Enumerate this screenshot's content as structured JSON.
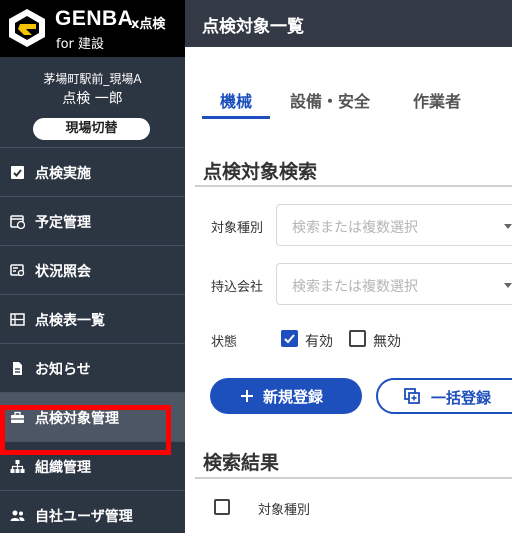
{
  "brand": {
    "name": "GENBA",
    "suffix": "x点検",
    "sub": "for 建設"
  },
  "user": {
    "site": "茅場町駅前_現場A",
    "name": "点検 一郎",
    "switch_label": "現場切替"
  },
  "sidebar": {
    "items": [
      {
        "label": "点検実施",
        "icon": "clipboard-check-icon"
      },
      {
        "label": "予定管理",
        "icon": "calendar-clock-icon"
      },
      {
        "label": "状況照会",
        "icon": "status-search-icon"
      },
      {
        "label": "点検表一覧",
        "icon": "table-icon"
      },
      {
        "label": "お知らせ",
        "icon": "document-icon"
      },
      {
        "label": "点検対象管理",
        "icon": "toolbox-icon",
        "active": true
      },
      {
        "label": "組織管理",
        "icon": "org-chart-icon"
      },
      {
        "label": "自社ユーザ管理",
        "icon": "users-icon"
      }
    ]
  },
  "header": {
    "title": "点検対象一覧"
  },
  "tabs": [
    {
      "label": "機械",
      "active": true
    },
    {
      "label": "設備・安全",
      "active": false
    },
    {
      "label": "作業者",
      "active": false
    }
  ],
  "search": {
    "title": "点検対象検索",
    "type_label": "対象種別",
    "type_placeholder": "検索または複数選択",
    "company_label": "持込会社",
    "company_placeholder": "検索または複数選択",
    "status_label": "状態",
    "status_valid": "有効",
    "status_invalid": "無効",
    "status_valid_checked": true,
    "status_invalid_checked": false
  },
  "actions": {
    "new_label": "新規登録",
    "bulk_label": "一括登録"
  },
  "results": {
    "title": "検索結果",
    "column_type": "対象種別"
  },
  "colors": {
    "accent": "#1d4fbd",
    "sidebar": "#2c3542",
    "highlight": "#ff0000"
  }
}
